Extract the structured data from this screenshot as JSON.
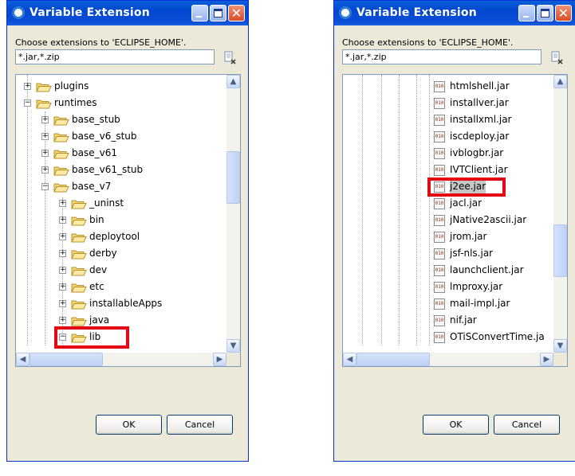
{
  "dialogs": [
    {
      "title": "Variable Extension",
      "prompt": "Choose extensions to 'ECLIPSE_HOME'.",
      "filter_value": "*.jar,*.zip",
      "ok_label": "OK",
      "cancel_label": "Cancel",
      "tree": [
        {
          "label": "plugins",
          "kind": "folder",
          "depth": 0,
          "expander": "+"
        },
        {
          "label": "runtimes",
          "kind": "folder",
          "depth": 0,
          "expander": "-"
        },
        {
          "label": "base_stub",
          "kind": "folder",
          "depth": 1,
          "expander": "+"
        },
        {
          "label": "base_v6_stub",
          "kind": "folder",
          "depth": 1,
          "expander": "+"
        },
        {
          "label": "base_v61",
          "kind": "folder",
          "depth": 1,
          "expander": "+"
        },
        {
          "label": "base_v61_stub",
          "kind": "folder",
          "depth": 1,
          "expander": "+"
        },
        {
          "label": "base_v7",
          "kind": "folder",
          "depth": 1,
          "expander": "-"
        },
        {
          "label": "_uninst",
          "kind": "folder",
          "depth": 2,
          "expander": "+"
        },
        {
          "label": "bin",
          "kind": "folder",
          "depth": 2,
          "expander": "+"
        },
        {
          "label": "deploytool",
          "kind": "folder",
          "depth": 2,
          "expander": "+"
        },
        {
          "label": "derby",
          "kind": "folder",
          "depth": 2,
          "expander": "+"
        },
        {
          "label": "dev",
          "kind": "folder",
          "depth": 2,
          "expander": "+"
        },
        {
          "label": "etc",
          "kind": "folder",
          "depth": 2,
          "expander": "+"
        },
        {
          "label": "installableApps",
          "kind": "folder",
          "depth": 2,
          "expander": "+"
        },
        {
          "label": "java",
          "kind": "folder",
          "depth": 2,
          "expander": "+"
        },
        {
          "label": "lib",
          "kind": "folder",
          "depth": 2,
          "expander": "-",
          "highlighted": true
        }
      ]
    },
    {
      "title": "Variable Extension",
      "prompt": "Choose extensions to 'ECLIPSE_HOME'.",
      "filter_value": "*.jar,*.zip",
      "ok_label": "OK",
      "cancel_label": "Cancel",
      "tree": [
        {
          "label": "htmlshell.jar",
          "kind": "file"
        },
        {
          "label": "installver.jar",
          "kind": "file"
        },
        {
          "label": "installxml.jar",
          "kind": "file"
        },
        {
          "label": "iscdeploy.jar",
          "kind": "file"
        },
        {
          "label": "ivblogbr.jar",
          "kind": "file"
        },
        {
          "label": "IVTClient.jar",
          "kind": "file"
        },
        {
          "label": "j2ee.jar",
          "kind": "file",
          "selected": true,
          "highlighted": true
        },
        {
          "label": "jacl.jar",
          "kind": "file"
        },
        {
          "label": "jNative2ascii.jar",
          "kind": "file"
        },
        {
          "label": "jrom.jar",
          "kind": "file"
        },
        {
          "label": "jsf-nls.jar",
          "kind": "file"
        },
        {
          "label": "launchclient.jar",
          "kind": "file"
        },
        {
          "label": "lmproxy.jar",
          "kind": "file"
        },
        {
          "label": "mail-impl.jar",
          "kind": "file"
        },
        {
          "label": "nif.jar",
          "kind": "file"
        },
        {
          "label": "OTiSConvertTime.ja",
          "kind": "file"
        }
      ]
    }
  ],
  "colors": {
    "highlight": "#e30613",
    "titlebar": "#0247cf",
    "dialog_bg": "#ece9d8"
  }
}
